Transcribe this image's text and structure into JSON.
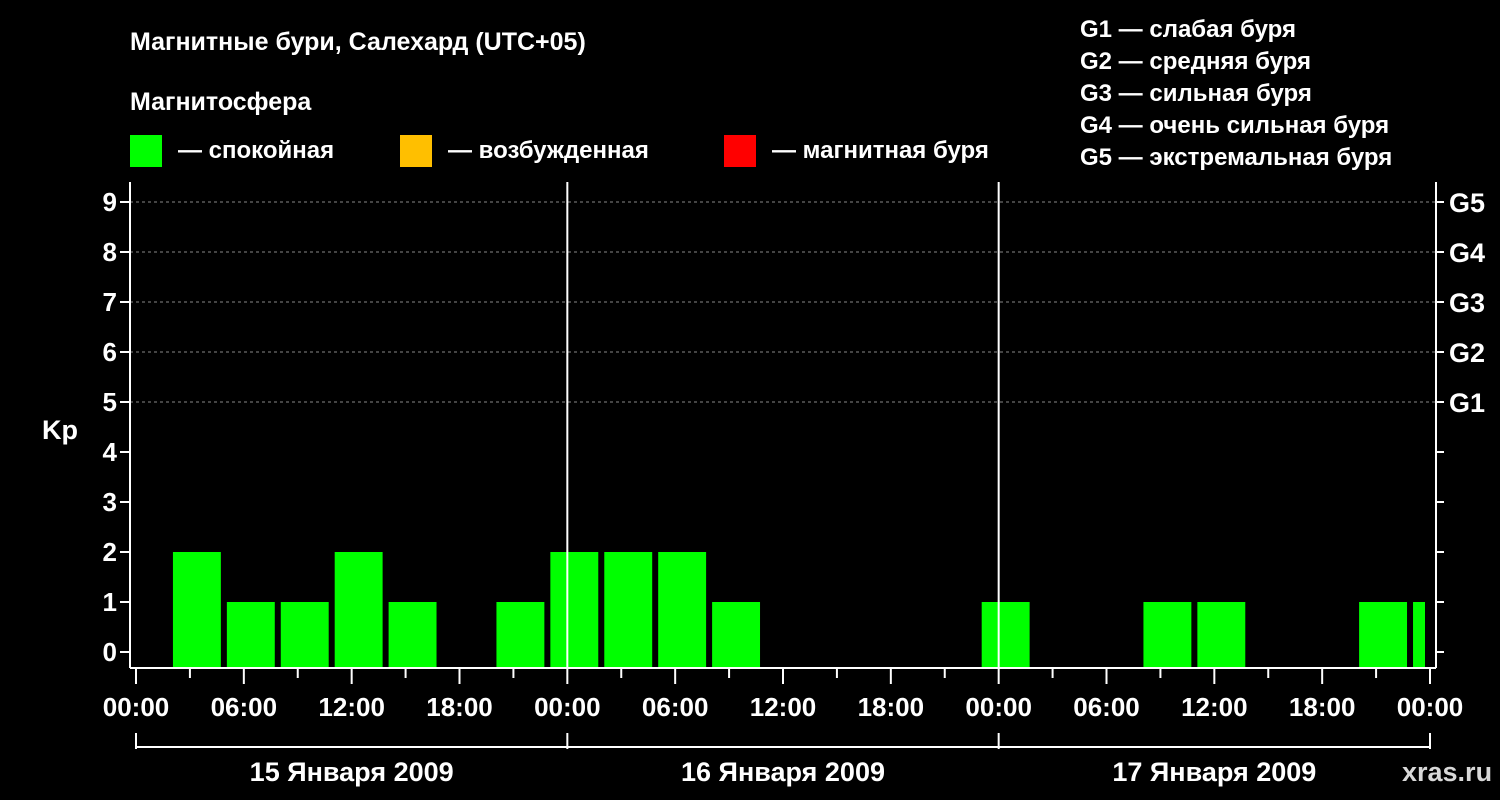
{
  "header": {
    "title": "Магнитные бури, Салехард (UTC+05)",
    "legend_title": "Магнитосфера",
    "watermark": "xras.ru"
  },
  "legend": [
    {
      "label": "— спокойная",
      "color": "#00ff00"
    },
    {
      "label": "— возбужденная",
      "color": "#ffbf00"
    },
    {
      "label": "— магнитная буря",
      "color": "#ff0000"
    }
  ],
  "g_scale": [
    "G1 — слабая буря",
    "G2 — средняя буря",
    "G3 — сильная буря",
    "G4 — очень сильная буря",
    "G5 — экстремальная буря"
  ],
  "chart_data": {
    "type": "bar",
    "ylabel": "Kp",
    "ylim": [
      0,
      9
    ],
    "yticks": [
      "0",
      "1",
      "2",
      "3",
      "4",
      "5",
      "6",
      "7",
      "8",
      "9"
    ],
    "right_ticks": [
      {
        "value": 5,
        "label": "G1"
      },
      {
        "value": 6,
        "label": "G2"
      },
      {
        "value": 7,
        "label": "G3"
      },
      {
        "value": 8,
        "label": "G4"
      },
      {
        "value": 9,
        "label": "G5"
      }
    ],
    "grid_levels": [
      5,
      6,
      7,
      8,
      9
    ],
    "x_range_hours": [
      0,
      72
    ],
    "xticks": [
      {
        "h": 0,
        "label": "00:00"
      },
      {
        "h": 6,
        "label": "06:00"
      },
      {
        "h": 12,
        "label": "12:00"
      },
      {
        "h": 18,
        "label": "18:00"
      },
      {
        "h": 24,
        "label": "00:00"
      },
      {
        "h": 30,
        "label": "06:00"
      },
      {
        "h": 36,
        "label": "12:00"
      },
      {
        "h": 42,
        "label": "18:00"
      },
      {
        "h": 48,
        "label": "00:00"
      },
      {
        "h": 54,
        "label": "06:00"
      },
      {
        "h": 60,
        "label": "12:00"
      },
      {
        "h": 66,
        "label": "18:00"
      },
      {
        "h": 72,
        "label": "00:00"
      }
    ],
    "days": [
      "15 Января 2009",
      "16 Января 2009",
      "17 Января 2009"
    ],
    "bar_color": "#00ff00",
    "bars": [
      {
        "start": 2,
        "end": 5,
        "kp": 2
      },
      {
        "start": 5,
        "end": 8,
        "kp": 1
      },
      {
        "start": 8,
        "end": 11,
        "kp": 1
      },
      {
        "start": 11,
        "end": 14,
        "kp": 2
      },
      {
        "start": 14,
        "end": 17,
        "kp": 1
      },
      {
        "start": 17,
        "end": 20,
        "kp": 0
      },
      {
        "start": 20,
        "end": 23,
        "kp": 1
      },
      {
        "start": 23,
        "end": 26,
        "kp": 2
      },
      {
        "start": 26,
        "end": 29,
        "kp": 2
      },
      {
        "start": 29,
        "end": 32,
        "kp": 2
      },
      {
        "start": 32,
        "end": 35,
        "kp": 1
      },
      {
        "start": 35,
        "end": 38,
        "kp": 0
      },
      {
        "start": 38,
        "end": 41,
        "kp": 0
      },
      {
        "start": 41,
        "end": 44,
        "kp": 0
      },
      {
        "start": 44,
        "end": 47,
        "kp": 0
      },
      {
        "start": 47,
        "end": 50,
        "kp": 1
      },
      {
        "start": 50,
        "end": 53,
        "kp": 0
      },
      {
        "start": 53,
        "end": 56,
        "kp": 0
      },
      {
        "start": 56,
        "end": 59,
        "kp": 1
      },
      {
        "start": 59,
        "end": 62,
        "kp": 1
      },
      {
        "start": 62,
        "end": 65,
        "kp": 0
      },
      {
        "start": 65,
        "end": 68,
        "kp": 0
      },
      {
        "start": 68,
        "end": 71,
        "kp": 1
      },
      {
        "start": 71,
        "end": 72,
        "kp": 1
      }
    ]
  }
}
